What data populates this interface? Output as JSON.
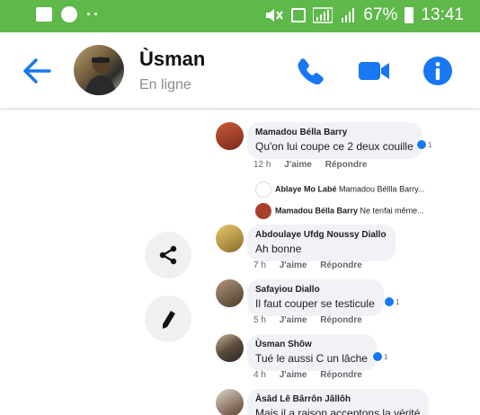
{
  "status_bar": {
    "battery": "67%",
    "time": "13:41"
  },
  "header": {
    "contact_name": "Ùsman",
    "contact_status": "En ligne"
  },
  "colors": {
    "status_bar": "#5fb84a",
    "accent": "#1877f2",
    "bubble": "#f0f2f5"
  },
  "comments": [
    {
      "author": "Mamadou Bélla Barry",
      "text": "Qu'on lui coupe ce 2 deux couille",
      "reactions": "1",
      "time": "12 h",
      "like_label": "J'aime",
      "reply_label": "Répondre",
      "replies": [
        {
          "author": "Ablaye Mo Labé",
          "preview": "Mamadou Béllla Barry..."
        },
        {
          "author": "Mamadou Bélla Barry",
          "preview": "Ne tenfai même..."
        }
      ]
    },
    {
      "author": "Abdoulaye Ufdg Noussy Diallo",
      "text": "Ah bonne",
      "time": "7 h",
      "like_label": "J'aime",
      "reply_label": "Répondre"
    },
    {
      "author": "Safayiou Diallo",
      "text": "Il faut couper se testicule",
      "reactions": "1",
      "time": "5 h",
      "like_label": "J'aime",
      "reply_label": "Répondre"
    },
    {
      "author": "Ùsman Shôw",
      "text": "Tué le aussi C un lâche",
      "reactions": "1",
      "time": "4 h",
      "like_label": "J'aime",
      "reply_label": "Répondre"
    },
    {
      "author": "Àsâd Lê Bârrôn Jâllôh",
      "text": "Mais il a raison acceptons la vérité"
    }
  ]
}
